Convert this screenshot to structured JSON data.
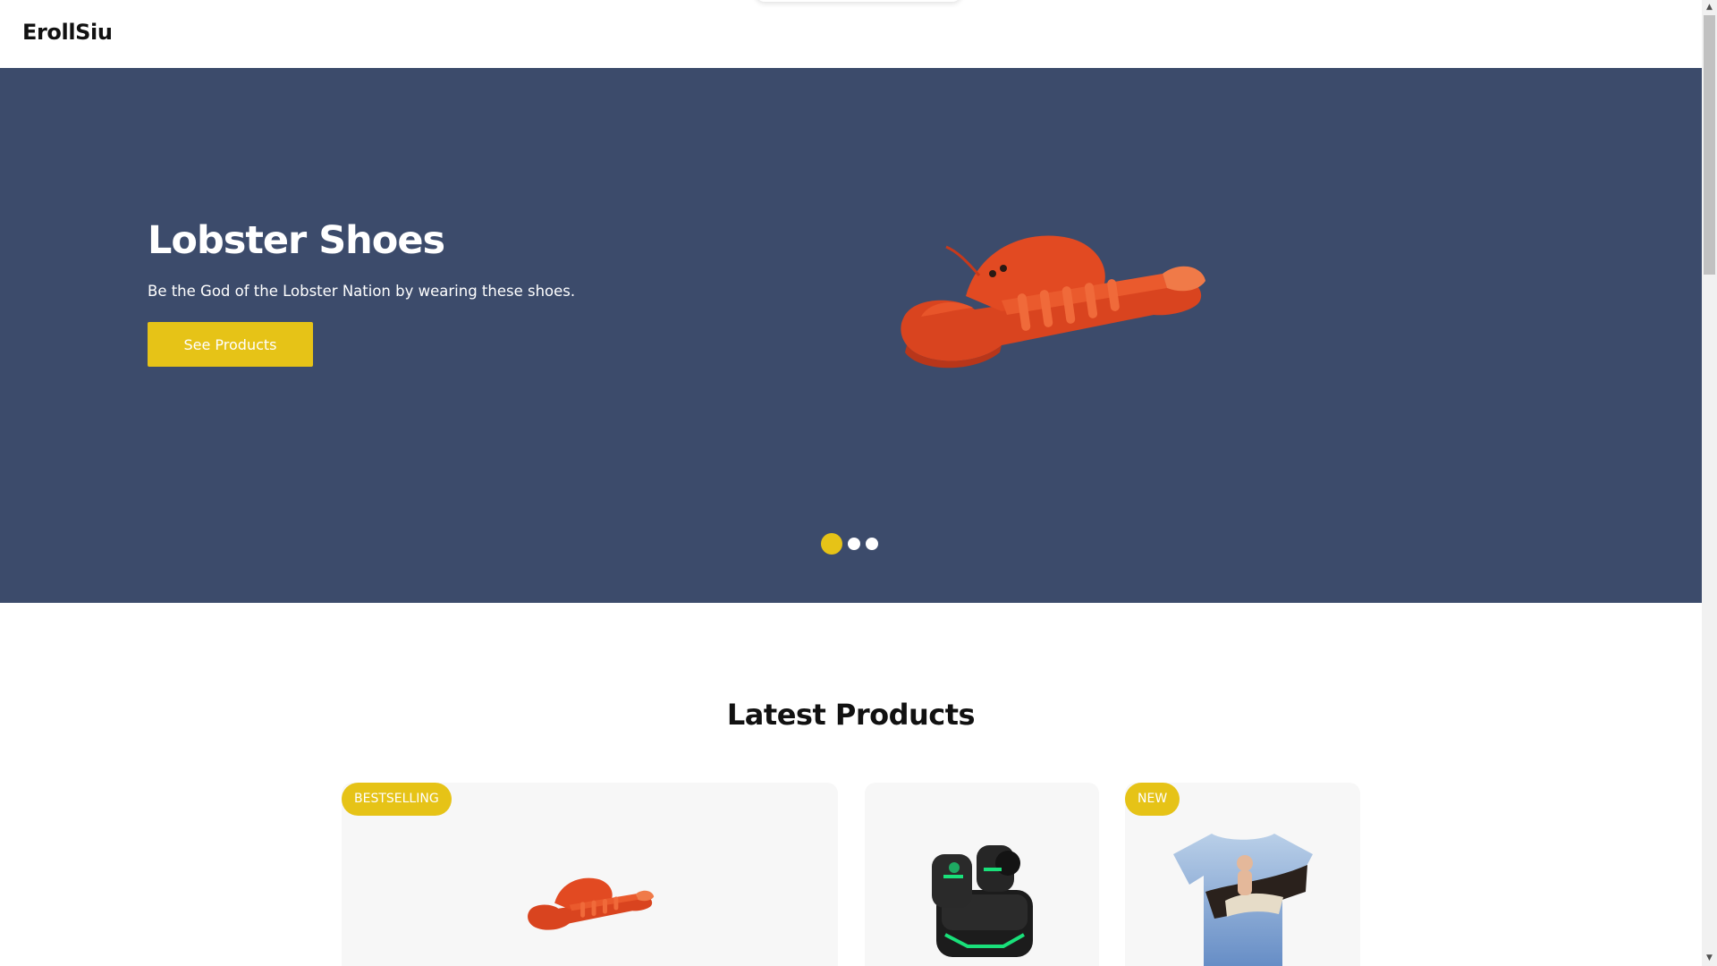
{
  "header": {
    "brand": "ErollSiu"
  },
  "hero": {
    "title": "Lobster Shoes",
    "description": "Be the God of the Lobster Nation by wearing these shoes.",
    "button_label": "See Products",
    "slide_count": 3,
    "active_slide": 1
  },
  "products_section": {
    "title": "Latest Products",
    "cards": [
      {
        "badge": "BESTSELLING",
        "image": "lobster-shoe"
      },
      {
        "badge": "",
        "image": "gaming-earbuds"
      },
      {
        "badge": "NEW",
        "image": "eagle-tshirt"
      }
    ]
  },
  "colors": {
    "hero_background": "#3c4b6b",
    "accent": "#e6c317",
    "card_background": "#f7f7f7"
  },
  "icons": {
    "scroll_up": "▲",
    "scroll_down": "▼"
  }
}
